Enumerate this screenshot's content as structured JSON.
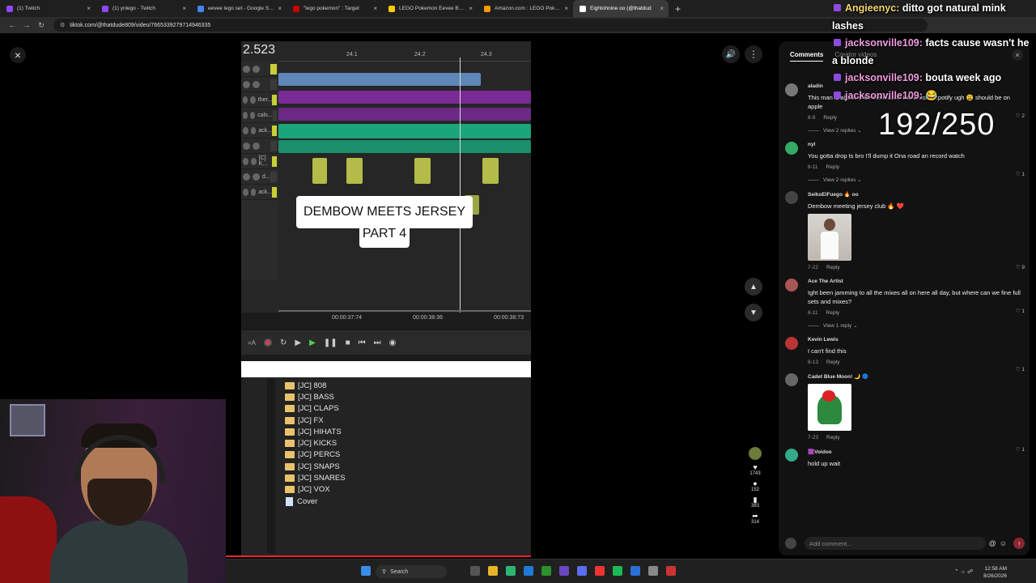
{
  "browser": {
    "tabs": [
      {
        "title": "(1) Twitch",
        "color": "#9146ff",
        "active": false
      },
      {
        "title": "(1) ynlego - Twitch",
        "color": "#9146ff",
        "active": false
      },
      {
        "title": "eevee lego set - Google Search",
        "color": "#4285f4",
        "active": false
      },
      {
        "title": "\"lego pokemon\" : Target",
        "color": "#cc0000",
        "active": false
      },
      {
        "title": "LEGO Pokemon Eevee Building",
        "color": "#ffcc00",
        "active": false
      },
      {
        "title": "Amazon.com : LEGO Pokemon",
        "color": "#ff9900",
        "active": false
      },
      {
        "title": "Eightohnine oo (@thatdud",
        "color": "#ffffff",
        "active": true
      }
    ],
    "new_tab": "+",
    "url": "tiktok.com/@thatdude809/video/7665339279714946335"
  },
  "video": {
    "bpm": "2.523",
    "ruler_marks": [
      "24.1",
      "24.2",
      "24.3"
    ],
    "track_names": [
      "",
      "",
      "ther...",
      "cals...",
      "ack...",
      "",
      "[C] K...",
      "d...",
      "ack..."
    ],
    "title_line1": "DEMBOW MEETS JERSEY CLUB",
    "title_line2": "PART 4",
    "timecodes": [
      "00:00:37:74",
      "00:00:38:36",
      "00:00:38:73"
    ],
    "mode_label": "=A",
    "folders": [
      "[JC] 808",
      "[JC] BASS",
      "[JC] CLAPS",
      "[JC] FX",
      "[JC] HIHATS",
      "[JC] KICKS",
      "[JC] PERCS",
      "[JC] SNAPS",
      "[JC] SNARES",
      "[JC] VOX"
    ],
    "file": "Cover"
  },
  "actions": {
    "likes": "1743",
    "comments": "152",
    "saves": "383",
    "shares": "314"
  },
  "comments_panel": {
    "tab_comments": "Comments",
    "tab_creator": "Creator videos",
    "items": [
      {
        "name": "aladin",
        "text": "This man is about to be the reason I download Spotify ugh 😩 should be on apple",
        "date": "8-9",
        "reply": "Reply",
        "likes": "2",
        "replies": "View 2 replies",
        "avatar": "#777",
        "image": ""
      },
      {
        "name": "nyl",
        "text": "You gotta drop ts bro I'll dump it Ona road an record watch",
        "date": "8-11",
        "reply": "Reply",
        "likes": "1",
        "replies": "View 2 replies",
        "avatar": "#3a6",
        "image": ""
      },
      {
        "name": "SeikoElFuego 🔥 oo",
        "text": "Dembow meeting jersey club 🔥 ❤️",
        "date": "7-22",
        "reply": "Reply",
        "likes": "9",
        "replies": "",
        "avatar": "#444",
        "image": "person"
      },
      {
        "name": "Ace The Artist",
        "text": "Ight been jamming to all the mixes all on here all day, but where can we fine full sets and mixes?",
        "date": "8-11",
        "reply": "Reply",
        "likes": "1",
        "replies": "View 1 reply",
        "avatar": "#a55",
        "image": ""
      },
      {
        "name": "Kevin Lewis",
        "text": "I can't find this",
        "date": "8-13",
        "reply": "Reply",
        "likes": "1",
        "replies": "",
        "avatar": "#b33",
        "image": ""
      },
      {
        "name": "Cadet Blue Moon! 🌙 🔵",
        "text": "",
        "date": "7-23",
        "reply": "Reply",
        "likes": "1",
        "replies": "",
        "avatar": "#666",
        "image": "art"
      },
      {
        "name": "🟪Voidoo",
        "text": "hold up wait",
        "date": "",
        "reply": "",
        "likes": "",
        "replies": "",
        "avatar": "#3a8",
        "image": ""
      }
    ],
    "input_placeholder": "Add comment..."
  },
  "chat": [
    {
      "user": "Angieenyc:",
      "text": "ditto got natural mink",
      "cont": "lashes"
    },
    {
      "user": "jacksonville109:",
      "text": "facts cause wasn't he",
      "cont": "a blonde"
    },
    {
      "user": "jacksonville109:",
      "text": "bouta week ago",
      "cont": ""
    },
    {
      "user": "jacksonville109:",
      "text": "😂",
      "cont": ""
    }
  ],
  "counter": "192/250",
  "taskbar": {
    "search": "Search",
    "time": "12:58 AM",
    "date": "8/26/2026"
  }
}
